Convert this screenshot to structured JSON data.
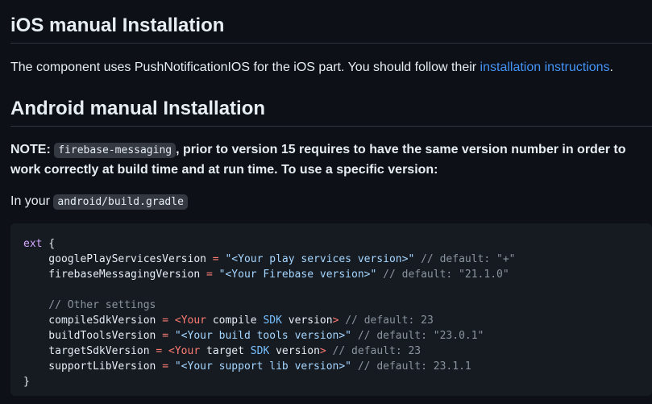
{
  "ios_heading": "iOS manual Installation",
  "ios_para": {
    "text": "The component uses PushNotificationIOS for the iOS part. You should follow their ",
    "link": "installation instructions",
    "end": "."
  },
  "android_heading": "Android manual Installation",
  "note": {
    "label": "NOTE:",
    "code": "firebase-messaging",
    "text": ", prior to version 15 requires to have the same version number in order to work correctly at build time and at run time. To use a specific version:"
  },
  "in_your": {
    "text": "In your",
    "code": "android/build.gradle"
  },
  "code_lines": {
    "l1_ext": "ext",
    "l1_brace": " {",
    "l2_key": "    googlePlayServicesVersion",
    "l2_eq": " = ",
    "l2_str": "\"<Your play services version>\"",
    "l2_cm": " // default: \"+\"",
    "l3_key": "    firebaseMessagingVersion",
    "l3_eq": " = ",
    "l3_str": "\"<Your Firebase version>\"",
    "l3_cm": " // default: \"21.1.0\"",
    "l5_cm": "    // Other settings",
    "l6_key": "    compileSdkVersion",
    "l6_eq": " = ",
    "l6_lt": "<",
    "l6_a": "Your",
    "l6_b": " compile ",
    "l6_c": "SDK",
    "l6_d": " version",
    "l6_gt": ">",
    "l6_cm": " // default: 23",
    "l7_key": "    buildToolsVersion",
    "l7_eq": " = ",
    "l7_str": "\"<Your build tools version>\"",
    "l7_cm": " // default: \"23.0.1\"",
    "l8_key": "    targetSdkVersion",
    "l8_eq": " = ",
    "l8_lt": "<",
    "l8_a": "Your",
    "l8_b": " target ",
    "l8_c": "SDK",
    "l8_d": " version",
    "l8_gt": ">",
    "l8_cm": " // default: 23",
    "l9_key": "    supportLibVersion",
    "l9_eq": " = ",
    "l9_str": "\"<Your support lib version>\"",
    "l9_cm": " // default: 23.1.1",
    "l10_brace": "}"
  }
}
